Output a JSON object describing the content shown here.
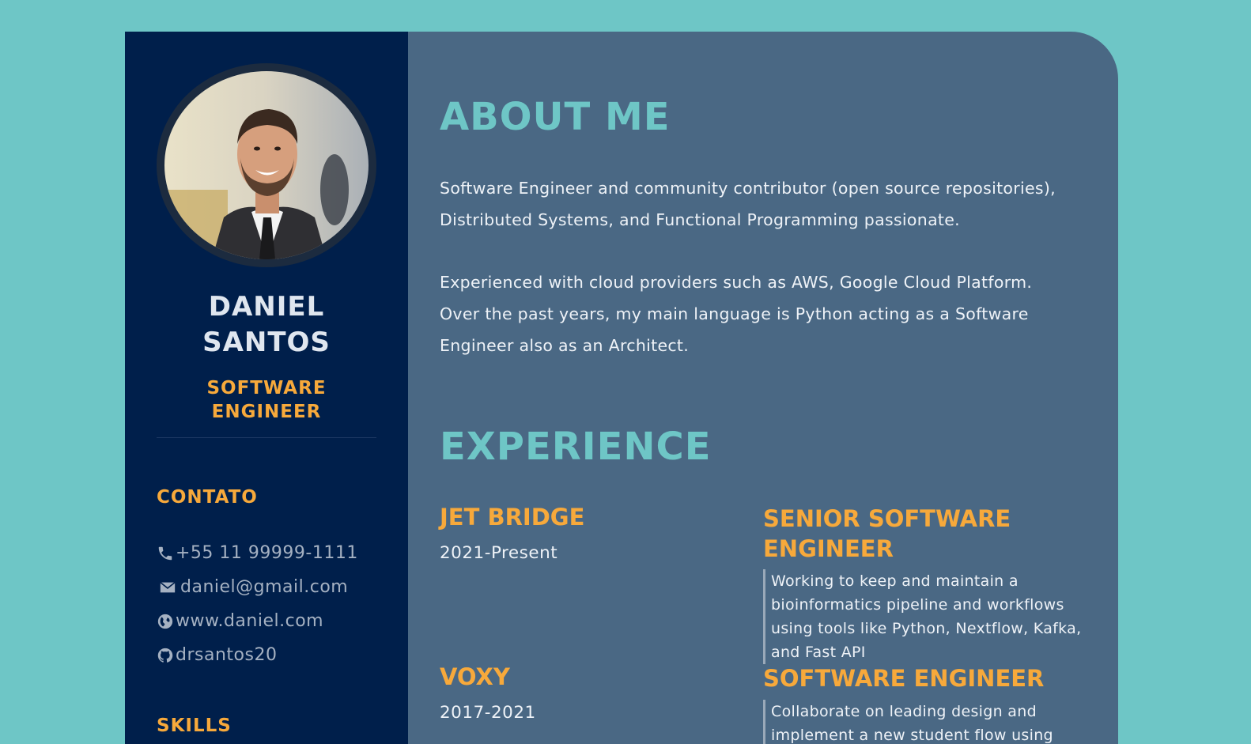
{
  "profile": {
    "name_first": "DANIEL",
    "name_last": "SANTOS",
    "role_line1": "SOFTWARE",
    "role_line2": "ENGINEER"
  },
  "contact": {
    "label": "CONTATO",
    "items": [
      {
        "icon": "phone-icon",
        "text": "+55 11 99999-1111"
      },
      {
        "icon": "mail-icon",
        "text": "daniel@gmail.com"
      },
      {
        "icon": "globe-icon",
        "text": "www.daniel.com"
      },
      {
        "icon": "github-icon",
        "text": "drsantos20"
      }
    ]
  },
  "skills": {
    "label": "SKILLS"
  },
  "about": {
    "heading": "ABOUT ME",
    "paragraph1_line1": "Software Engineer and community contributor (open source repositories),",
    "paragraph1_line2": "Distributed Systems, and Functional Programming passionate.",
    "paragraph2_line1": "Experienced with cloud providers such as AWS, Google Cloud Platform.",
    "paragraph2_line2": "Over the past years, my main language is Python acting as a Software",
    "paragraph2_line3": "Engineer also as an Architect."
  },
  "experience": {
    "heading": "EXPERIENCE",
    "jobs": [
      {
        "company": "JET BRIDGE",
        "period": "2021-Present",
        "title_line1": "SENIOR SOFTWARE",
        "title_line2": "ENGINEER",
        "description": "Working to keep and maintain a bioinformatics pipeline and workflows using tools like Python, Nextflow, Kafka, and Fast API"
      },
      {
        "company": "VOXY",
        "period": "2017-2021",
        "title_line1": "SOFTWARE ENGINEER",
        "description": "Collaborate on leading design and implement a new student flow using"
      }
    ]
  },
  "colors": {
    "background": "#6ec6c6",
    "sidebar": "#001f4b",
    "main": "#4a6884",
    "accent_orange": "#f7a93b",
    "accent_teal": "#6ec6c6"
  }
}
